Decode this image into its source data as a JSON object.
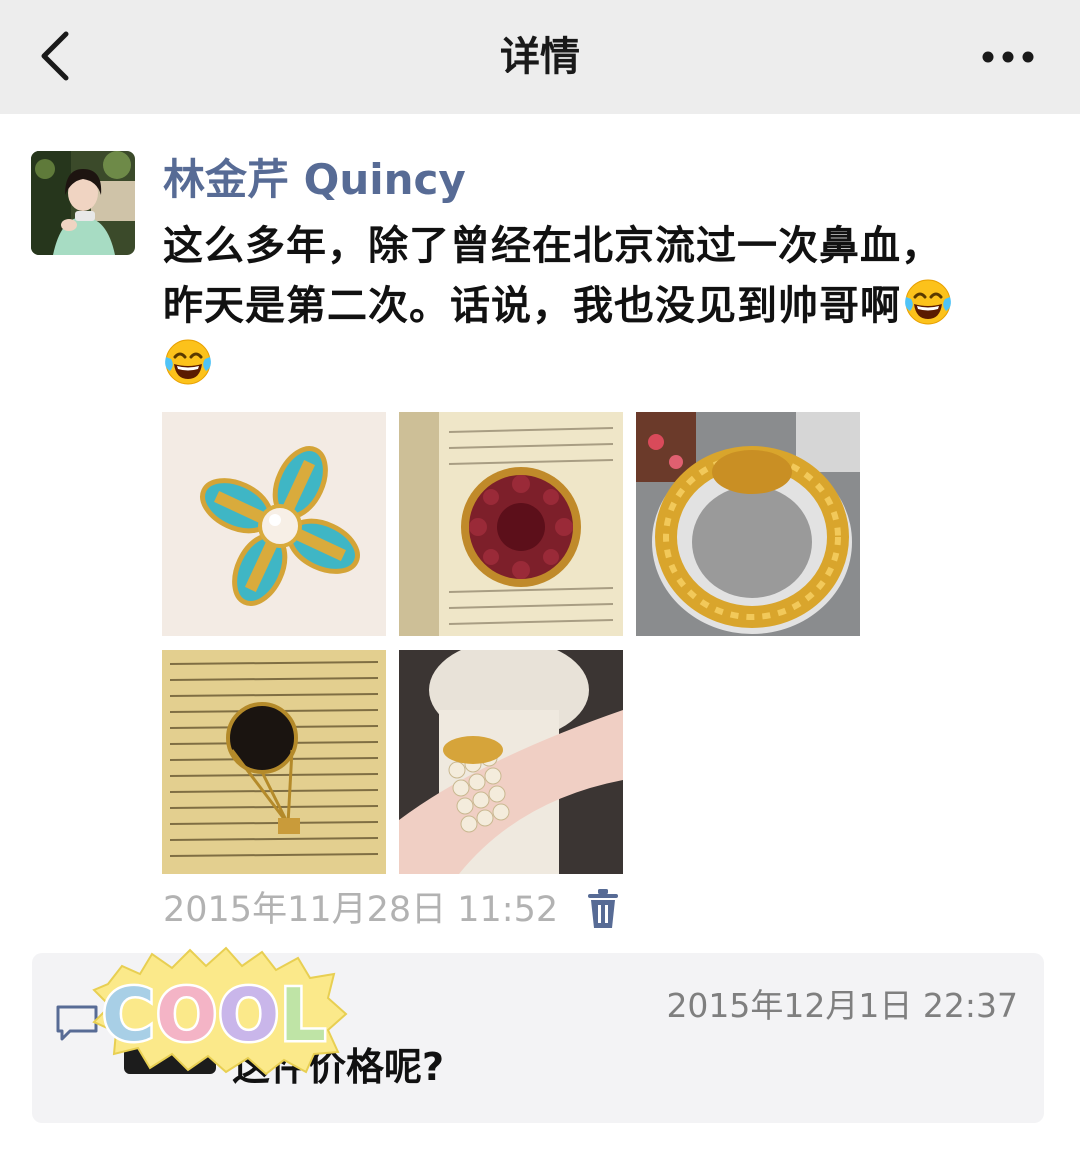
{
  "nav": {
    "title": "详情",
    "back_icon": "chevron-left-icon",
    "more_icon": "more-dots-icon"
  },
  "post": {
    "author": "林金芹 Quincy",
    "text_line1": "这么多年，除了曾经在北京流过一次鼻血，",
    "text_line2": "昨天是第二次。话说，我也没见到帅哥啊",
    "emoji": "tears-of-joy-emoji",
    "photos": [
      "turquoise-flower-brooch",
      "red-jewel-brooch",
      "gold-bangle",
      "hot-air-balloon-brooch",
      "pearl-cuff-bracelet"
    ],
    "timestamp": "2015年11月28日 11:52",
    "delete_icon": "trash-icon"
  },
  "comment": {
    "icon": "comment-bubble-icon",
    "time": "2015年12月1日 22:37",
    "text": "这件价格呢?",
    "sticker": "COOL"
  },
  "colors": {
    "navbar_bg": "#ededed",
    "author_name": "#576b95",
    "timestamp": "#b2b2b2",
    "comment_bg": "#f3f3f5"
  }
}
